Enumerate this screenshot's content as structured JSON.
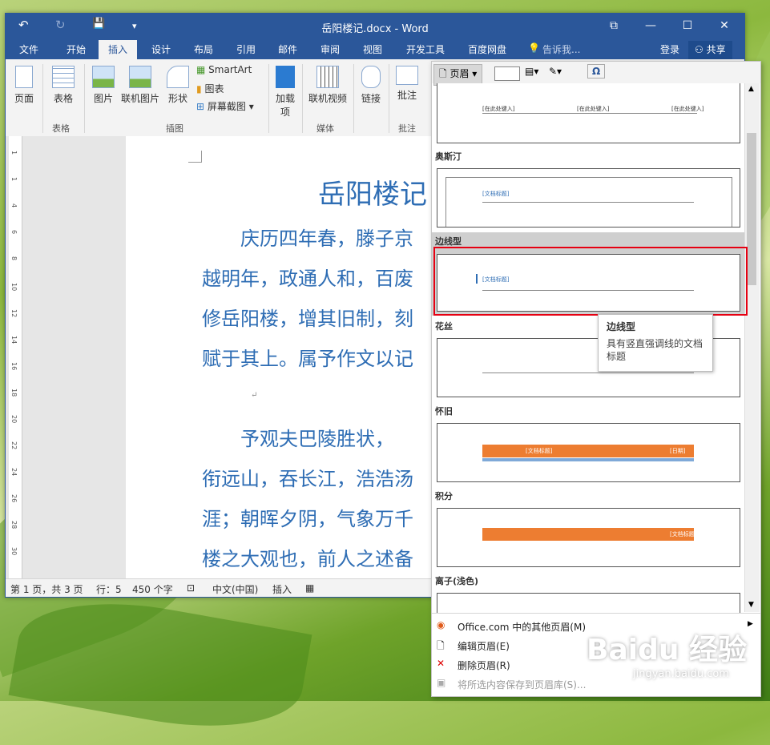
{
  "window": {
    "title": "岳阳楼记.docx - Word",
    "undo": "↶",
    "redo": "↻",
    "save": "💾",
    "qat_more": "▾",
    "restore": "⧉",
    "minimize": "—",
    "maximize": "☐",
    "close": "✕"
  },
  "tabs": [
    "文件",
    "开始",
    "插入",
    "设计",
    "布局",
    "引用",
    "邮件",
    "审阅",
    "视图",
    "开发工具",
    "百度网盘"
  ],
  "tell_me": "告诉我...",
  "login": "登录",
  "share": "共享",
  "ribbon": {
    "page": "页面",
    "table": "表格",
    "picture": "图片",
    "online_picture": "联机图片",
    "shapes": "形状",
    "smartart": "SmartArt",
    "chart": "图表",
    "screenshot": "屏幕截图",
    "addins": "加载项",
    "online_video": "联机视频",
    "link": "链接",
    "comment": "批注",
    "header": "页眉",
    "groups": {
      "table": "表格",
      "illustrations": "插图",
      "media": "媒体",
      "comments": "批注"
    }
  },
  "document": {
    "title": "岳阳楼记",
    "lines": [
      "　　庆历四年春，滕子京",
      "越明年，政通人和，百废",
      "修岳阳楼，增其旧制，刻",
      "赋于其上。属予作文以记",
      "↵",
      "　　予观夫巴陵胜状，",
      "衔远山，吞长江，浩浩汤",
      "涯；朝晖夕阴，气象万千",
      "楼之大观也，前人之述备"
    ]
  },
  "ruler_numbers": [
    "1",
    "1",
    "4",
    "6",
    "8",
    "10",
    "12",
    "14",
    "16",
    "18",
    "20",
    "22",
    "24",
    "26",
    "28",
    "30"
  ],
  "status": {
    "page": "第 1 页，共 3 页",
    "line": "行：5",
    "words": "450 个字",
    "lang": "中文(中国)",
    "mode": "插入"
  },
  "gallery": {
    "sections": [
      "奥斯汀",
      "边线型",
      "花丝",
      "怀旧",
      "积分",
      "离子(浅色)"
    ],
    "thumb_texts": {
      "blank_left": "[在此处键入]",
      "blank_mid": "[在此处键入]",
      "blank_right": "[在此处键入]",
      "austin": "[文档标题]",
      "sideline": "[文档标题]",
      "retro_left": "[文档标题]",
      "retro_right": "[日期]",
      "integral": "[文档标题]"
    },
    "menu": [
      "Office.com 中的其他页眉(M)",
      "编辑页眉(E)",
      "删除页眉(R)",
      "将所选内容保存到页眉库(S)..."
    ]
  },
  "tooltip": {
    "title": "边线型",
    "desc": "具有竖直强调线的文档标题"
  },
  "watermark": {
    "logo": "Baidu 经验",
    "url": "jingyan.baidu.com"
  },
  "colors": {
    "word_blue": "#2b579a",
    "text_blue": "#2e6db4",
    "highlight_red": "#e60012",
    "orange": "#ed7d31"
  }
}
